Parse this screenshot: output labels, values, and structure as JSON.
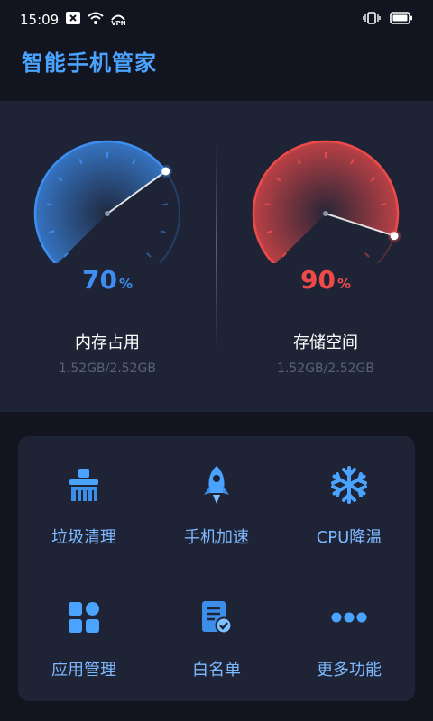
{
  "status_bar": {
    "time": "15:09",
    "vpn_label": "VPN",
    "icons": [
      "notification-x-icon",
      "wifi-icon",
      "vpn-icon",
      "vibrate-icon",
      "battery-icon"
    ]
  },
  "header": {
    "title": "智能手机管家"
  },
  "gauges": [
    {
      "percent_value": "70",
      "percent_unit": "%",
      "fraction": 0.7,
      "label": "内存占用",
      "detail": "1.52GB/2.52GB",
      "color": "#3d8ef0"
    },
    {
      "percent_value": "90",
      "percent_unit": "%",
      "fraction": 0.9,
      "label": "存储空间",
      "detail": "1.52GB/2.52GB",
      "color": "#ee4a4a"
    }
  ],
  "tools": [
    {
      "label": "垃圾清理",
      "icon": "broom-icon"
    },
    {
      "label": "手机加速",
      "icon": "rocket-icon"
    },
    {
      "label": "CPU降温",
      "icon": "snowflake-icon"
    },
    {
      "label": "应用管理",
      "icon": "app-grid-icon"
    },
    {
      "label": "白名单",
      "icon": "whitelist-icon"
    },
    {
      "label": "更多功能",
      "icon": "more-dots-icon"
    }
  ],
  "colors": {
    "accent": "#4aa3ff",
    "tool_label": "#7eb8ff",
    "panel_bg": "#1e2436",
    "page_bg": "#12151f"
  }
}
